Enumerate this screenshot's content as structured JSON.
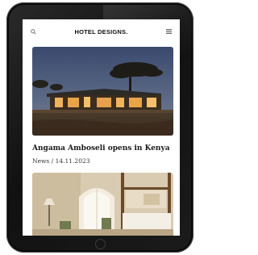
{
  "header": {
    "logo": "HOTEL DESIGNS.",
    "search_icon": "search-icon",
    "menu_icon": "menu-icon"
  },
  "articles": [
    {
      "title": "Angama Amboseli opens in Kenya",
      "category": "News",
      "date": "14.11.2023",
      "meta": "News / 14.11.2023",
      "image": "lodge-at-dusk-photo"
    },
    {
      "image": "hotel-bedroom-photo"
    }
  ],
  "colors": {
    "bezel": "#161616",
    "screen_bg": "#ffffff",
    "text": "#1a1a1a"
  }
}
